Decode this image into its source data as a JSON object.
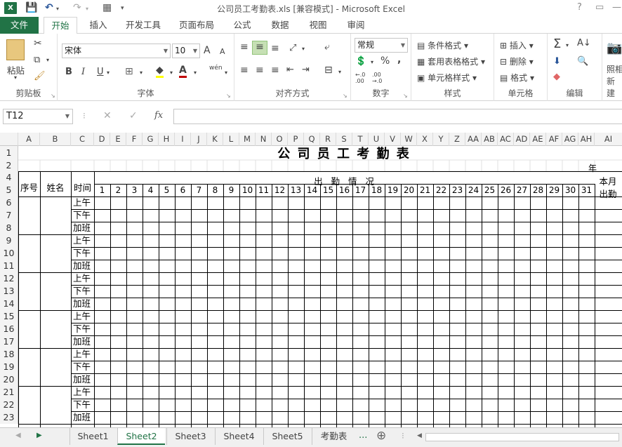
{
  "app": {
    "title": "公司员工考勤表.xls  [兼容模式] - Microsoft Excel",
    "help": "?",
    "restore": "▭"
  },
  "ribbon_tabs": [
    "文件",
    "开始",
    "插入",
    "开发工具",
    "页面布局",
    "公式",
    "数据",
    "视图",
    "审阅"
  ],
  "clipboard": {
    "paste": "粘贴",
    "label": "剪贴板"
  },
  "font": {
    "name": "宋体",
    "size": "10",
    "grow": "A",
    "shrink": "A",
    "bold": "B",
    "italic": "I",
    "underline": "U",
    "label": "字体",
    "phonetic": "wén"
  },
  "alignment": {
    "label": "对齐方式"
  },
  "number": {
    "format": "常规",
    "percent": "%",
    "comma": ",",
    "label": "数字"
  },
  "styles": {
    "conditional": "条件格式",
    "table": "套用表格格式",
    "cell": "单元格样式",
    "label": "样式"
  },
  "cells": {
    "insert": "插入",
    "delete": "删除",
    "format": "格式",
    "label": "单元格"
  },
  "editing": {
    "label": "编辑"
  },
  "extra": {
    "photo": "照相",
    "new": "新建"
  },
  "formula_bar": {
    "cell_ref": "T12",
    "cancel": "✕",
    "confirm": "✓",
    "fx": "fx",
    "value": ""
  },
  "columns": [
    "A",
    "B",
    "C",
    "D",
    "E",
    "F",
    "G",
    "H",
    "I",
    "J",
    "K",
    "L",
    "M",
    "N",
    "O",
    "P",
    "Q",
    "R",
    "S",
    "T",
    "U",
    "V",
    "W",
    "X",
    "Y",
    "Z",
    "AA",
    "AB",
    "AC",
    "AD",
    "AE",
    "AF",
    "AG",
    "AH",
    "AI"
  ],
  "rows": [
    "1",
    "2",
    "4",
    "5",
    "6",
    "7",
    "8",
    "9",
    "10",
    "11",
    "12",
    "13",
    "14",
    "15",
    "16",
    "17",
    "18",
    "19",
    "20",
    "21",
    "22",
    "23"
  ],
  "sheet": {
    "title": "公 司 员 工 考 勤 表",
    "year": "年",
    "seq": "序号",
    "name": "姓名",
    "time": "时间",
    "attendance": "出   勤   情   况",
    "month_total_1": "本月",
    "month_total_2": "出勤",
    "days": [
      "1",
      "2",
      "3",
      "4",
      "5",
      "6",
      "7",
      "8",
      "9",
      "10",
      "11",
      "12",
      "13",
      "14",
      "15",
      "16",
      "17",
      "18",
      "19",
      "20",
      "21",
      "22",
      "23",
      "24",
      "25",
      "26",
      "27",
      "28",
      "29",
      "30",
      "31"
    ],
    "periods": [
      "上午",
      "下午",
      "加班"
    ]
  },
  "sheets": [
    "Sheet1",
    "Sheet2",
    "Sheet3",
    "Sheet4",
    "Sheet5",
    "考勤表"
  ],
  "active_sheet": "Sheet2",
  "more_sheets": "...",
  "add_sheet": "⊕"
}
